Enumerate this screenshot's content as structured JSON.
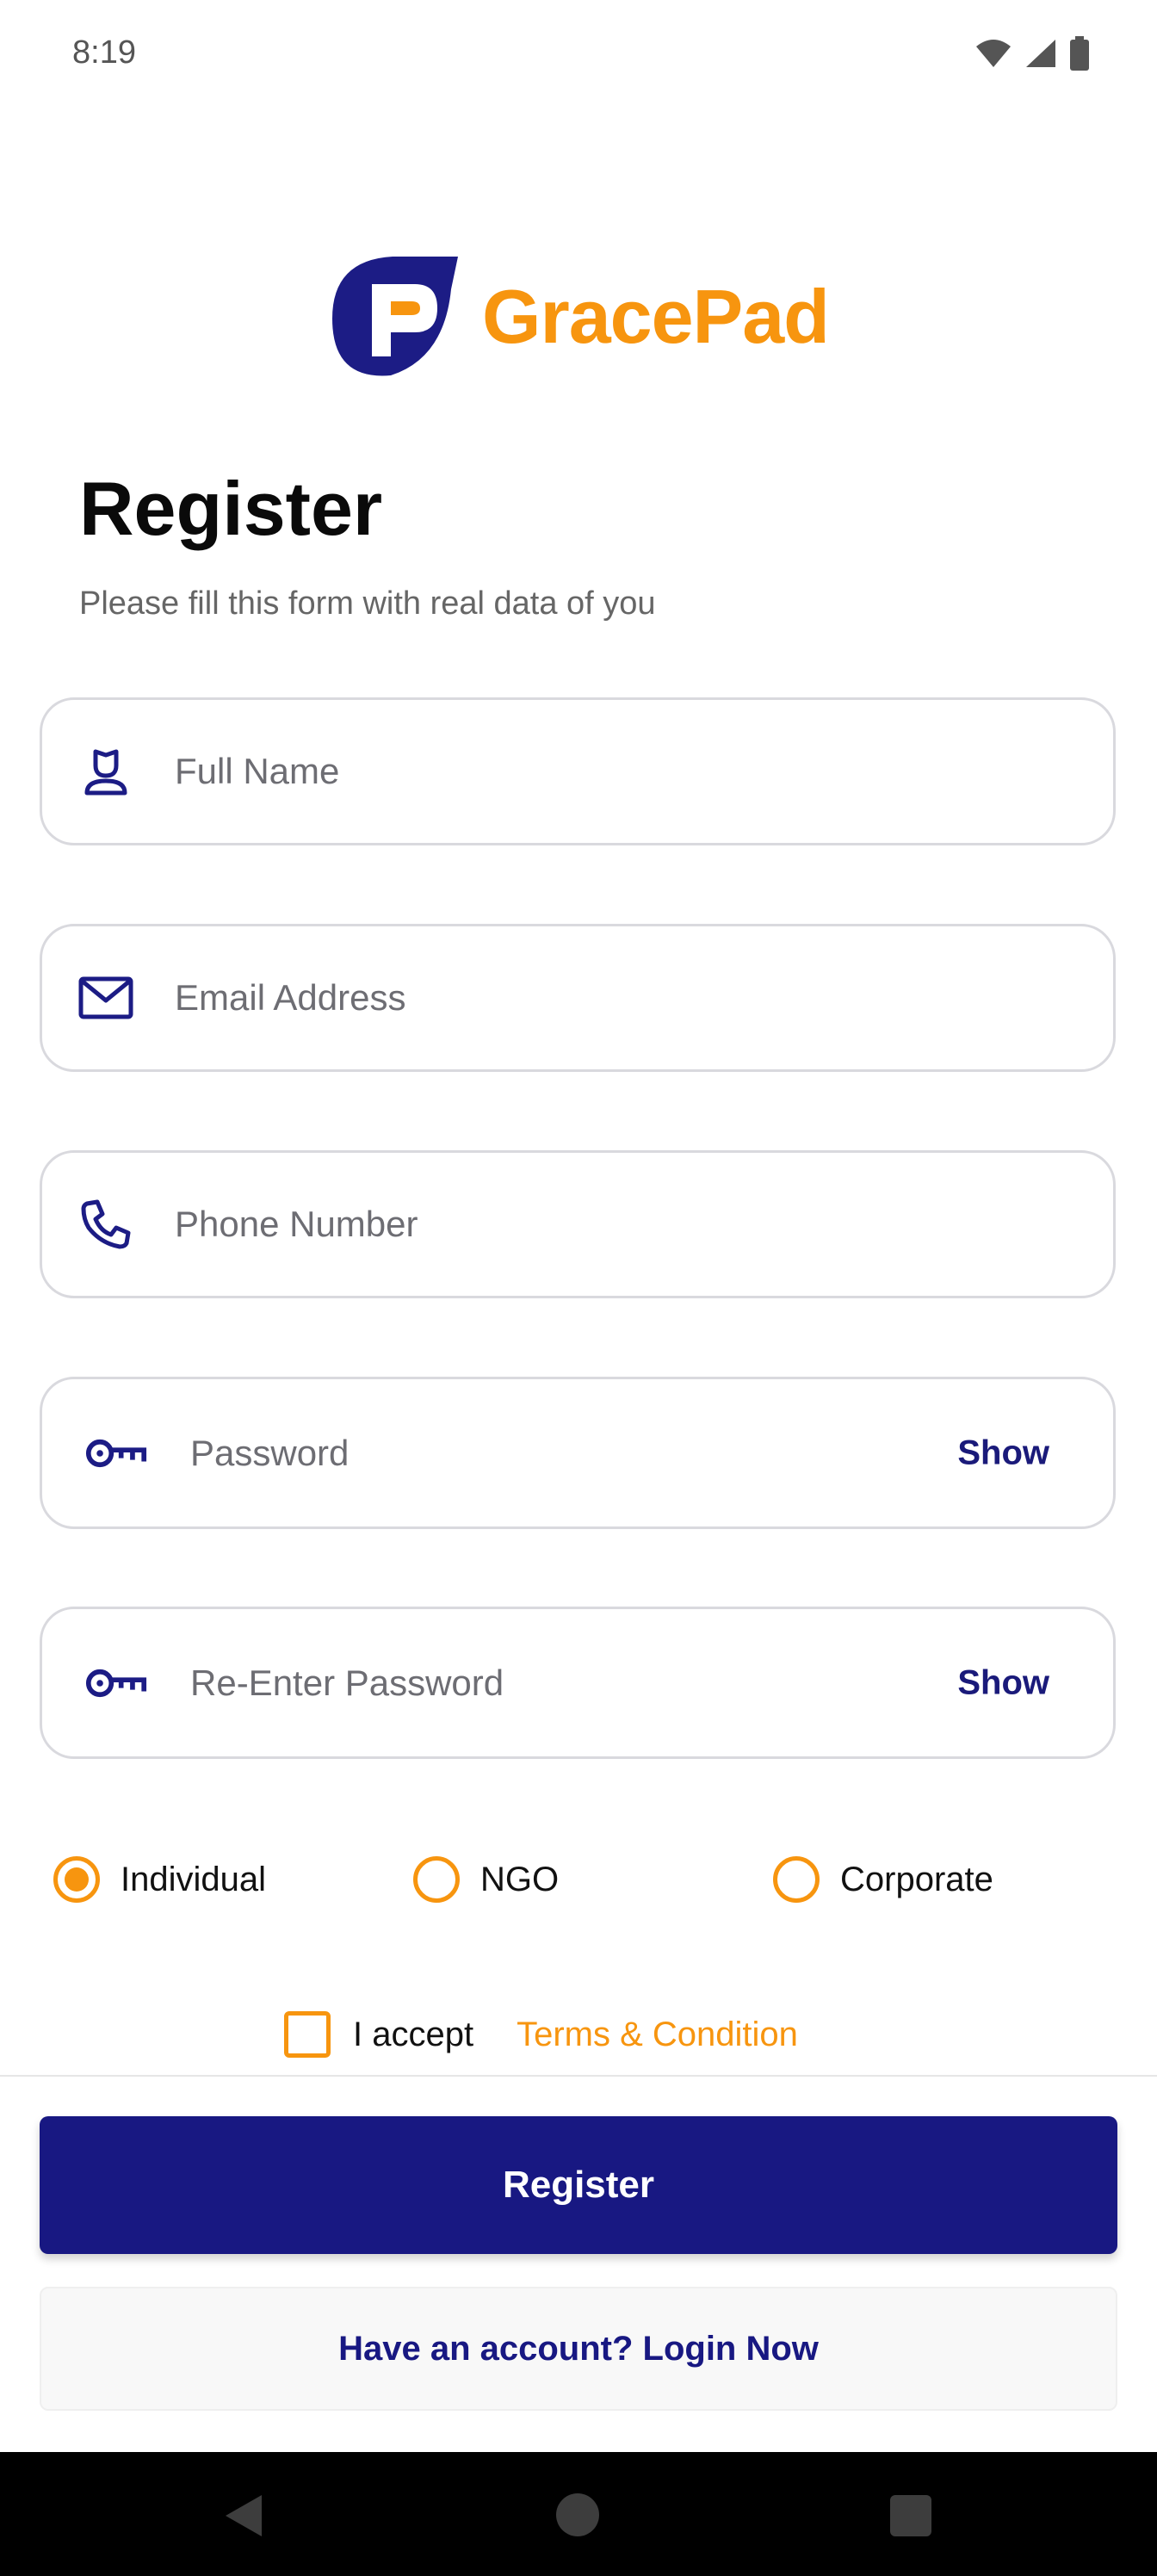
{
  "status": {
    "time": "8:19"
  },
  "brand": {
    "name": "GracePad",
    "accent": "#f7950f",
    "primary": "#181882"
  },
  "header": {
    "title": "Register",
    "subtitle": "Please fill this form with real data of you"
  },
  "form": {
    "full_name": {
      "placeholder": "Full Name",
      "icon": "person-icon"
    },
    "email": {
      "placeholder": "Email Address",
      "icon": "mail-icon"
    },
    "phone": {
      "placeholder": "Phone Number",
      "icon": "phone-icon"
    },
    "password": {
      "placeholder": "Password",
      "icon": "key-icon",
      "toggle": "Show"
    },
    "confirm_password": {
      "placeholder": "Re-Enter Password",
      "icon": "key-icon",
      "toggle": "Show"
    }
  },
  "account_type": {
    "options": [
      "Individual",
      "NGO",
      "Corporate"
    ],
    "selected": "Individual"
  },
  "terms": {
    "accept_label": "I accept",
    "link_label": "Terms & Condition",
    "checked": false
  },
  "actions": {
    "register_label": "Register",
    "login_label": "Have an account? Login Now"
  }
}
